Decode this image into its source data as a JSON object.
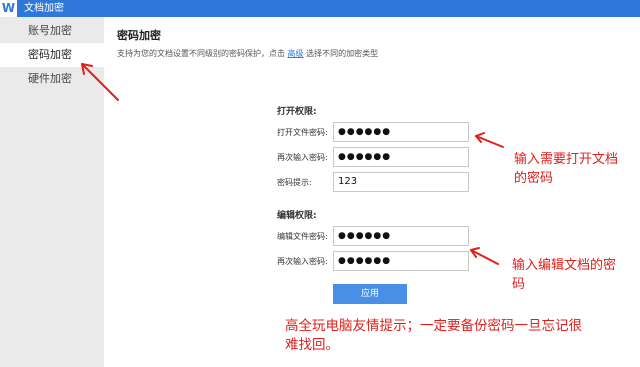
{
  "window": {
    "app_icon": "W",
    "title": "文档加密"
  },
  "sidebar": {
    "items": [
      {
        "label": "账号加密",
        "active": false
      },
      {
        "label": "密码加密",
        "active": true
      },
      {
        "label": "硬件加密",
        "active": false
      }
    ]
  },
  "main": {
    "section_title": "密码加密",
    "description_prefix": "支持为您的文档设置不同级别的密码保护，点击",
    "description_link": "高级",
    "description_suffix": "选择不同的加密类型",
    "open_group": {
      "label": "打开权限:",
      "password_label": "打开文件密码:",
      "password_value": "●●●●●●",
      "confirm_label": "再次输入密码:",
      "confirm_value": "●●●●●●",
      "hint_label": "密码提示:",
      "hint_value": "123"
    },
    "edit_group": {
      "label": "编辑权限:",
      "password_label": "编辑文件密码:",
      "password_value": "●●●●●●",
      "confirm_label": "再次输入密码:",
      "confirm_value": "●●●●●●"
    },
    "apply_label": "应用"
  },
  "annotations": {
    "open_note_line1": "输入需要打开文档",
    "open_note_line2": "的密码",
    "edit_note_line1": "输入编辑文档的密",
    "edit_note_line2": "码",
    "tip_line1": "高全玩电脑友情提示；一定要备份密码一旦忘记很",
    "tip_line2": "难找回。",
    "color": "#e0201a"
  },
  "colors": {
    "accent": "#2f78d9",
    "button": "#4a8fe7",
    "sidebar_bg": "#eaeaea"
  }
}
